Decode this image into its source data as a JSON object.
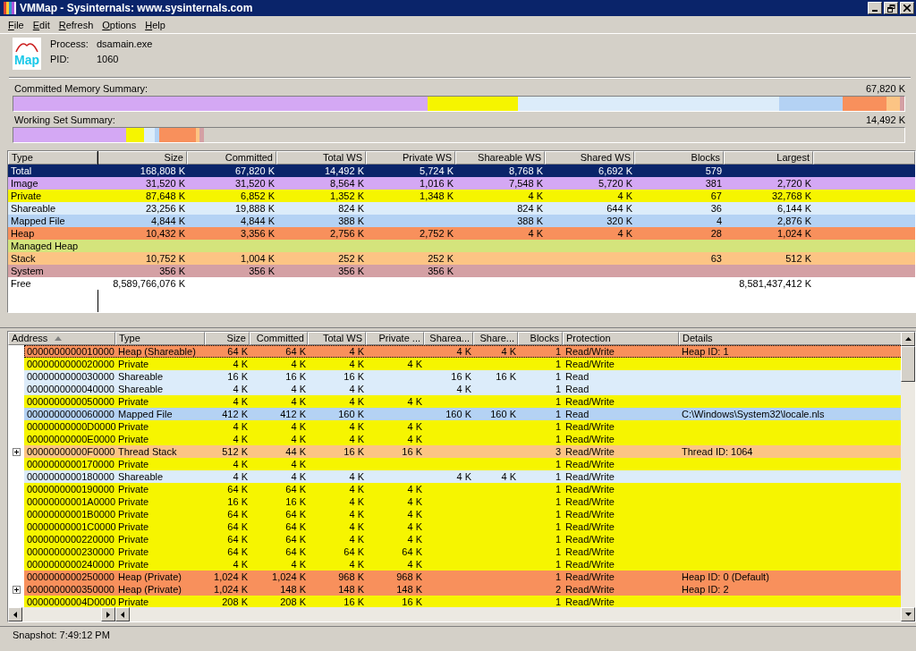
{
  "window": {
    "title": "VMMap - Sysinternals: www.sysinternals.com"
  },
  "menu": [
    "File",
    "Edit",
    "Refresh",
    "Options",
    "Help"
  ],
  "process": {
    "logo_text": "Map",
    "process_label": "Process:",
    "process_value": "dsamain.exe",
    "pid_label": "PID:",
    "pid_value": "1060"
  },
  "committed_summary": {
    "label": "Committed Memory Summary:",
    "total": "67,820 K"
  },
  "working_set_summary": {
    "label": "Working Set Summary:",
    "total": "14,492 K"
  },
  "summary": {
    "columns": [
      "Type",
      "Size",
      "Committed",
      "Total WS",
      "Private WS",
      "Shareable WS",
      "Shared WS",
      "Blocks",
      "Largest"
    ],
    "rows": [
      {
        "selected": true,
        "cells": [
          "Total",
          "168,808 K",
          "67,820 K",
          "14,492 K",
          "5,724 K",
          "8,768 K",
          "6,692 K",
          "579",
          ""
        ]
      },
      {
        "selected": false,
        "color": "#d4a8f4",
        "cells": [
          "Image",
          "31,520 K",
          "31,520 K",
          "8,564 K",
          "1,016 K",
          "7,548 K",
          "5,720 K",
          "381",
          "2,720 K"
        ]
      },
      {
        "selected": false,
        "color": "#f6f500",
        "cells": [
          "Private",
          "87,648 K",
          "6,852 K",
          "1,352 K",
          "1,348 K",
          "4 K",
          "4 K",
          "67",
          "32,768 K"
        ]
      },
      {
        "selected": false,
        "color": "#dcecfa",
        "cells": [
          "Shareable",
          "23,256 K",
          "19,888 K",
          "824 K",
          "",
          "824 K",
          "644 K",
          "36",
          "6,144 K"
        ]
      },
      {
        "selected": false,
        "color": "#b4d2f4",
        "cells": [
          "Mapped File",
          "4,844 K",
          "4,844 K",
          "388 K",
          "",
          "388 K",
          "320 K",
          "4",
          "2,876 K"
        ]
      },
      {
        "selected": false,
        "color": "#f8905c",
        "cells": [
          "Heap",
          "10,432 K",
          "3,356 K",
          "2,756 K",
          "2,752 K",
          "4 K",
          "4 K",
          "28",
          "1,024 K"
        ]
      },
      {
        "selected": false,
        "color": "#d4e47c",
        "cells": [
          "Managed Heap",
          "",
          "",
          "",
          "",
          "",
          "",
          "",
          ""
        ]
      },
      {
        "selected": false,
        "color": "#fcc484",
        "cells": [
          "Stack",
          "10,752 K",
          "1,004 K",
          "252 K",
          "252 K",
          "",
          "",
          "63",
          "512 K"
        ]
      },
      {
        "selected": false,
        "color": "#d4a0a4",
        "cells": [
          "System",
          "356 K",
          "356 K",
          "356 K",
          "356 K",
          "",
          "",
          "",
          ""
        ]
      },
      {
        "selected": false,
        "cells": [
          "Free",
          "8,589,766,076 K",
          "",
          "",
          "",
          "",
          "",
          "",
          "8,581,437,412 K"
        ]
      }
    ]
  },
  "details": {
    "columns": [
      {
        "label": "Address",
        "sorted": true
      },
      {
        "label": "Type",
        "sorted": false
      },
      {
        "label": "Size",
        "sorted": false
      },
      {
        "label": "Committed",
        "sorted": false
      },
      {
        "label": "Total WS",
        "sorted": false
      },
      {
        "label": "Private ...",
        "sorted": false
      },
      {
        "label": "Sharea...",
        "sorted": false
      },
      {
        "label": "Share...",
        "sorted": false
      },
      {
        "label": "Blocks",
        "sorted": false
      },
      {
        "label": "Protection",
        "sorted": false
      },
      {
        "label": "Details",
        "sorted": false
      }
    ],
    "rows": [
      {
        "expandable": false,
        "focused": true,
        "color": "#f8905c",
        "cells": [
          "0000000000010000",
          "Heap (Shareable)",
          "64 K",
          "64 K",
          "4 K",
          "",
          "4 K",
          "4 K",
          "1",
          "Read/Write",
          "Heap ID: 1"
        ]
      },
      {
        "expandable": false,
        "focused": false,
        "color": "#f6f500",
        "cells": [
          "0000000000020000",
          "Private",
          "4 K",
          "4 K",
          "4 K",
          "4 K",
          "",
          "",
          "1",
          "Read/Write",
          ""
        ]
      },
      {
        "expandable": false,
        "focused": false,
        "color": "#dcecfa",
        "cells": [
          "0000000000030000",
          "Shareable",
          "16 K",
          "16 K",
          "16 K",
          "",
          "16 K",
          "16 K",
          "1",
          "Read",
          ""
        ]
      },
      {
        "expandable": false,
        "focused": false,
        "color": "#dcecfa",
        "cells": [
          "0000000000040000",
          "Shareable",
          "4 K",
          "4 K",
          "4 K",
          "",
          "4 K",
          "",
          "1",
          "Read",
          ""
        ]
      },
      {
        "expandable": false,
        "focused": false,
        "color": "#f6f500",
        "cells": [
          "0000000000050000",
          "Private",
          "4 K",
          "4 K",
          "4 K",
          "4 K",
          "",
          "",
          "1",
          "Read/Write",
          ""
        ]
      },
      {
        "expandable": false,
        "focused": false,
        "color": "#b4d2f4",
        "cells": [
          "0000000000060000",
          "Mapped File",
          "412 K",
          "412 K",
          "160 K",
          "",
          "160 K",
          "160 K",
          "1",
          "Read",
          "C:\\Windows\\System32\\locale.nls"
        ]
      },
      {
        "expandable": false,
        "focused": false,
        "color": "#f6f500",
        "cells": [
          "00000000000D0000",
          "Private",
          "4 K",
          "4 K",
          "4 K",
          "4 K",
          "",
          "",
          "1",
          "Read/Write",
          ""
        ]
      },
      {
        "expandable": false,
        "focused": false,
        "color": "#f6f500",
        "cells": [
          "00000000000E0000",
          "Private",
          "4 K",
          "4 K",
          "4 K",
          "4 K",
          "",
          "",
          "1",
          "Read/Write",
          ""
        ]
      },
      {
        "expandable": true,
        "focused": false,
        "color": "#fcc484",
        "cells": [
          "00000000000F0000",
          "Thread Stack",
          "512 K",
          "44 K",
          "16 K",
          "16 K",
          "",
          "",
          "3",
          "Read/Write",
          "Thread ID: 1064"
        ]
      },
      {
        "expandable": false,
        "focused": false,
        "color": "#f6f500",
        "cells": [
          "0000000000170000",
          "Private",
          "4 K",
          "4 K",
          "",
          "",
          "",
          "",
          "1",
          "Read/Write",
          ""
        ]
      },
      {
        "expandable": false,
        "focused": false,
        "color": "#dcecfa",
        "cells": [
          "0000000000180000",
          "Shareable",
          "4 K",
          "4 K",
          "4 K",
          "",
          "4 K",
          "4 K",
          "1",
          "Read/Write",
          ""
        ]
      },
      {
        "expandable": false,
        "focused": false,
        "color": "#f6f500",
        "cells": [
          "0000000000190000",
          "Private",
          "64 K",
          "64 K",
          "4 K",
          "4 K",
          "",
          "",
          "1",
          "Read/Write",
          ""
        ]
      },
      {
        "expandable": false,
        "focused": false,
        "color": "#f6f500",
        "cells": [
          "00000000001A0000",
          "Private",
          "16 K",
          "16 K",
          "4 K",
          "4 K",
          "",
          "",
          "1",
          "Read/Write",
          ""
        ]
      },
      {
        "expandable": false,
        "focused": false,
        "color": "#f6f500",
        "cells": [
          "00000000001B0000",
          "Private",
          "64 K",
          "64 K",
          "4 K",
          "4 K",
          "",
          "",
          "1",
          "Read/Write",
          ""
        ]
      },
      {
        "expandable": false,
        "focused": false,
        "color": "#f6f500",
        "cells": [
          "00000000001C0000",
          "Private",
          "64 K",
          "64 K",
          "4 K",
          "4 K",
          "",
          "",
          "1",
          "Read/Write",
          ""
        ]
      },
      {
        "expandable": false,
        "focused": false,
        "color": "#f6f500",
        "cells": [
          "0000000000220000",
          "Private",
          "64 K",
          "64 K",
          "4 K",
          "4 K",
          "",
          "",
          "1",
          "Read/Write",
          ""
        ]
      },
      {
        "expandable": false,
        "focused": false,
        "color": "#f6f500",
        "cells": [
          "0000000000230000",
          "Private",
          "64 K",
          "64 K",
          "64 K",
          "64 K",
          "",
          "",
          "1",
          "Read/Write",
          ""
        ]
      },
      {
        "expandable": false,
        "focused": false,
        "color": "#f6f500",
        "cells": [
          "0000000000240000",
          "Private",
          "4 K",
          "4 K",
          "4 K",
          "4 K",
          "",
          "",
          "1",
          "Read/Write",
          ""
        ]
      },
      {
        "expandable": false,
        "focused": false,
        "color": "#f8905c",
        "cells": [
          "0000000000250000",
          "Heap (Private)",
          "1,024 K",
          "1,024 K",
          "968 K",
          "968 K",
          "",
          "",
          "1",
          "Read/Write",
          "Heap ID: 0 (Default)"
        ]
      },
      {
        "expandable": true,
        "focused": false,
        "color": "#f8905c",
        "cells": [
          "0000000000350000",
          "Heap (Private)",
          "1,024 K",
          "148 K",
          "148 K",
          "148 K",
          "",
          "",
          "2",
          "Read/Write",
          "Heap ID: 2"
        ]
      },
      {
        "expandable": false,
        "focused": false,
        "color": "#f6f500",
        "cells": [
          "00000000004D0000",
          "Private",
          "208 K",
          "208 K",
          "16 K",
          "16 K",
          "",
          "",
          "1",
          "Read/Write",
          ""
        ]
      }
    ]
  },
  "status_bar": {
    "text": "Snapshot: 7:49:12 PM"
  }
}
